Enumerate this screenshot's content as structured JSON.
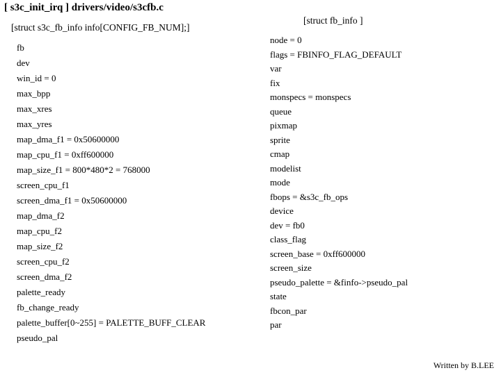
{
  "title": "[ s3c_init_irq ] drivers/video/s3cfb.c",
  "left": {
    "header": "[struct s3c_fb_info info[CONFIG_FB_NUM];]",
    "fields": [
      "fb",
      "dev",
      "win_id = 0",
      "max_bpp",
      "max_xres",
      "max_yres",
      "map_dma_f1 = 0x50600000",
      "map_cpu_f1 = 0xff600000",
      "map_size_f1 = 800*480*2 = 768000",
      "screen_cpu_f1",
      "screen_dma_f1 = 0x50600000",
      "map_dma_f2",
      "map_cpu_f2",
      "map_size_f2",
      "screen_cpu_f2",
      "screen_dma_f2",
      "palette_ready",
      "fb_change_ready",
      "palette_buffer[0~255] = PALETTE_BUFF_CLEAR",
      "pseudo_pal"
    ]
  },
  "right": {
    "header": "[struct fb_info ]",
    "fields": [
      "node = 0",
      "flags = FBINFO_FLAG_DEFAULT",
      "var",
      "fix",
      "monspecs = monspecs",
      "queue",
      "pixmap",
      "sprite",
      "cmap",
      "modelist",
      "mode",
      "fbops = &s3c_fb_ops",
      "device",
      "dev = fb0",
      "class_flag",
      "screen_base = 0xff600000",
      "screen_size",
      "pseudo_palette = &finfo->pseudo_pal",
      "state",
      "fbcon_par",
      "par"
    ]
  },
  "footer": "Written by B.LEE"
}
